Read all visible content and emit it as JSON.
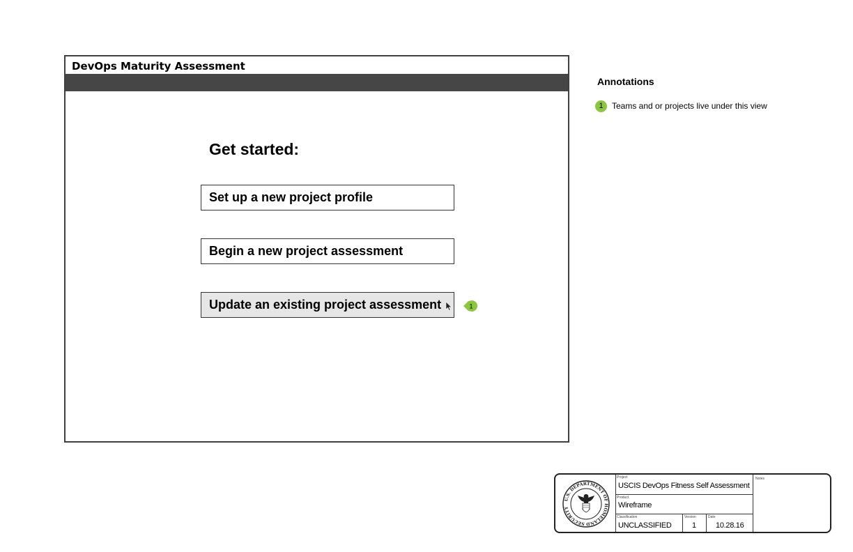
{
  "window": {
    "title": "DevOps Maturity Assessment"
  },
  "main": {
    "heading": "Get started:",
    "actions": [
      {
        "label": "Set up a new project profile"
      },
      {
        "label": "Begin a new project assessment"
      },
      {
        "label": "Update an existing project assessment"
      }
    ],
    "marker_number": "1"
  },
  "annotations": {
    "title": "Annotations",
    "items": [
      {
        "number": "1",
        "text": "Teams and or projects live under this view"
      }
    ],
    "badge_color": "#8cc63e"
  },
  "title_block": {
    "project_label": "Project",
    "project": "USCIS DevOps Fitness Self Assessment",
    "product_label": "Product",
    "product": "Wireframe",
    "classification_label": "Classification",
    "classification": "UNCLASSIFIED",
    "version_label": "Version",
    "version": "1",
    "date_label": "Date",
    "date": "10.28.16",
    "notes_label": "Notes",
    "seal_text": "U.S. DEPARTMENT OF HOMELAND SECURITY"
  }
}
